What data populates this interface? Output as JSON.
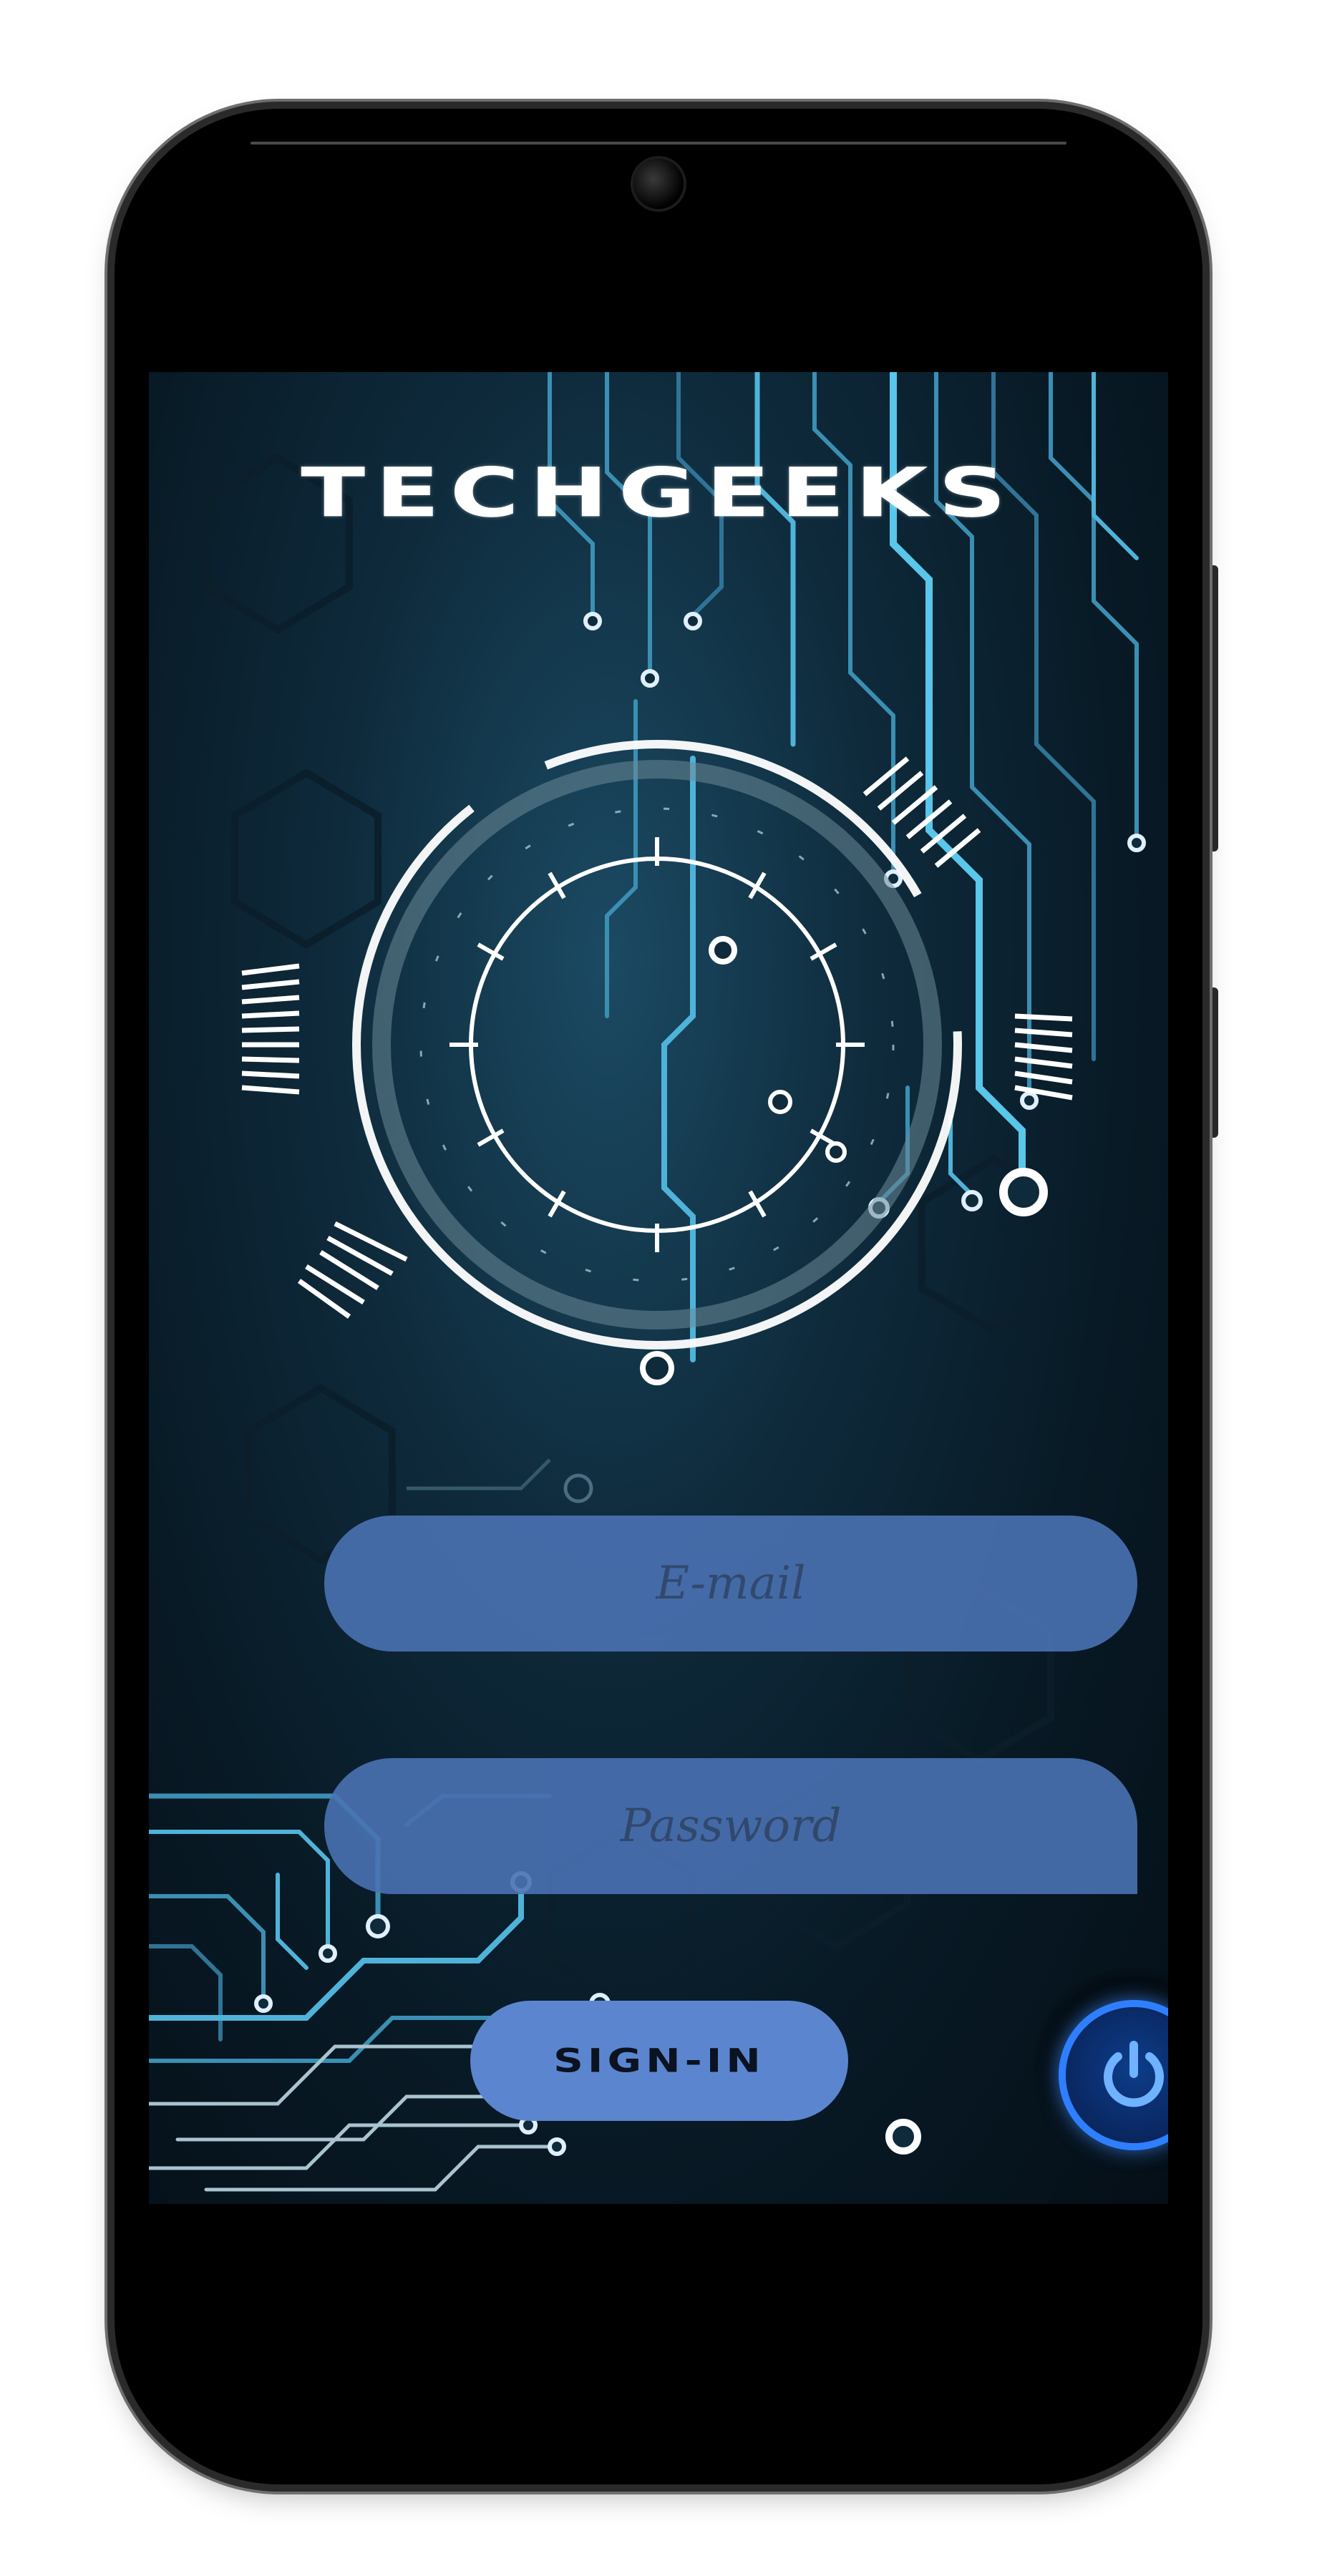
{
  "app": {
    "title": "TECHGEEKS"
  },
  "login": {
    "email_placeholder": "E-mail",
    "email_value": "",
    "password_placeholder": "Password",
    "password_value": "",
    "signin_label": "SIGN-IN"
  },
  "icons": {
    "power": "power-icon",
    "hud": "hud-circle-icon",
    "circuit": "circuit-pattern"
  },
  "colors": {
    "field_fill": "#4a72b3",
    "button_fill": "#5b86cf",
    "power_glow": "#2e7fff",
    "background": "#0e2a3b",
    "circuit_accent": "#4fb3d9"
  }
}
